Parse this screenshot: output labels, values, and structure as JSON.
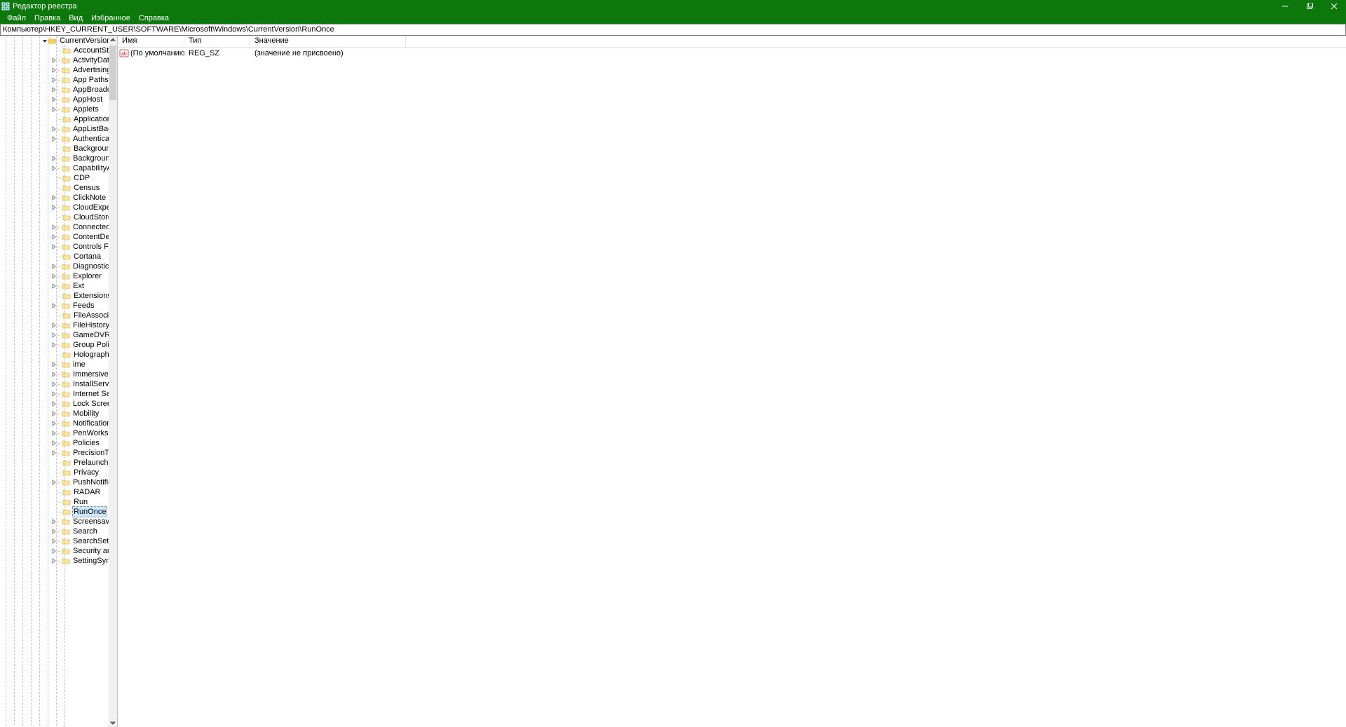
{
  "titlebar": {
    "title": "Редактор реестра"
  },
  "menubar": {
    "items": [
      "Файл",
      "Правка",
      "Вид",
      "Избранное",
      "Справка"
    ]
  },
  "addressbar": {
    "path": "Компьютер\\HKEY_CURRENT_USER\\SOFTWARE\\Microsoft\\Windows\\CurrentVersion\\RunOnce"
  },
  "tree": {
    "root_label": "CurrentVersion",
    "selected": "RunOnce",
    "children": [
      {
        "label": "AccountState",
        "expandable": false
      },
      {
        "label": "ActivityDataModel",
        "expandable": true
      },
      {
        "label": "AdvertisingInfo",
        "expandable": true
      },
      {
        "label": "App Paths",
        "expandable": true
      },
      {
        "label": "AppBroadcast",
        "expandable": true
      },
      {
        "label": "AppHost",
        "expandable": true
      },
      {
        "label": "Applets",
        "expandable": true
      },
      {
        "label": "ApplicationAssociationToasts",
        "expandable": false
      },
      {
        "label": "AppListBackup",
        "expandable": true
      },
      {
        "label": "Authentication",
        "expandable": true
      },
      {
        "label": "Background",
        "expandable": false
      },
      {
        "label": "BackgroundAccessApplications",
        "expandable": true
      },
      {
        "label": "CapabilityAccessManager",
        "expandable": true
      },
      {
        "label": "CDP",
        "expandable": false
      },
      {
        "label": "Census",
        "expandable": false
      },
      {
        "label": "ClickNote",
        "expandable": true
      },
      {
        "label": "CloudExperienceHost",
        "expandable": true
      },
      {
        "label": "CloudStore",
        "expandable": false
      },
      {
        "label": "ConnectedSearch",
        "expandable": true
      },
      {
        "label": "ContentDeliveryManager",
        "expandable": true
      },
      {
        "label": "Controls Folder",
        "expandable": true
      },
      {
        "label": "Cortana",
        "expandable": false
      },
      {
        "label": "Diagnostics",
        "expandable": true
      },
      {
        "label": "Explorer",
        "expandable": true
      },
      {
        "label": "Ext",
        "expandable": true
      },
      {
        "label": "Extensions",
        "expandable": false
      },
      {
        "label": "Feeds",
        "expandable": true
      },
      {
        "label": "FileAssociations",
        "expandable": false
      },
      {
        "label": "FileHistory",
        "expandable": true
      },
      {
        "label": "GameDVR",
        "expandable": true
      },
      {
        "label": "Group Policy",
        "expandable": true
      },
      {
        "label": "Holographic",
        "expandable": false
      },
      {
        "label": "ime",
        "expandable": true
      },
      {
        "label": "ImmersiveShell",
        "expandable": true
      },
      {
        "label": "InstallService",
        "expandable": true
      },
      {
        "label": "Internet Settings",
        "expandable": true
      },
      {
        "label": "Lock Screen",
        "expandable": true
      },
      {
        "label": "Mobility",
        "expandable": true
      },
      {
        "label": "Notifications",
        "expandable": true
      },
      {
        "label": "PenWorkspace",
        "expandable": true
      },
      {
        "label": "Policies",
        "expandable": true
      },
      {
        "label": "PrecisionTouchPad",
        "expandable": true
      },
      {
        "label": "Prelaunch",
        "expandable": false
      },
      {
        "label": "Privacy",
        "expandable": false
      },
      {
        "label": "PushNotifications",
        "expandable": true
      },
      {
        "label": "RADAR",
        "expandable": false
      },
      {
        "label": "Run",
        "expandable": false
      },
      {
        "label": "RunOnce",
        "expandable": false
      },
      {
        "label": "Screensavers",
        "expandable": true
      },
      {
        "label": "Search",
        "expandable": true
      },
      {
        "label": "SearchSettings",
        "expandable": true
      },
      {
        "label": "Security and Maintenance",
        "expandable": true
      },
      {
        "label": "SettingSync",
        "expandable": true
      }
    ]
  },
  "list": {
    "columns": {
      "name": "Имя",
      "type": "Тип",
      "value": "Значение"
    },
    "rows": [
      {
        "name": "(По умолчанию)",
        "type": "REG_SZ",
        "value": "(значение не присвоено)"
      }
    ]
  }
}
